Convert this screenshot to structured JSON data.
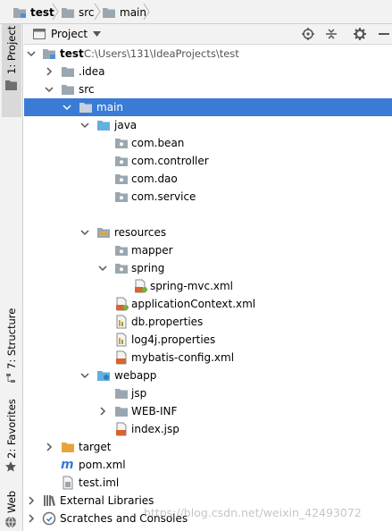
{
  "breadcrumb": {
    "items": [
      "test",
      "src",
      "main"
    ]
  },
  "stripe": {
    "project": "1: Project",
    "structure": "7: Structure",
    "favorites": "2: Favorites",
    "web": "Web"
  },
  "panel": {
    "view": "Project"
  },
  "tree": {
    "project_root": {
      "name": "test",
      "path": "C:\\Users\\131\\IdeaProjects\\test"
    },
    "idea": ".idea",
    "src": "src",
    "main": "main",
    "java": "java",
    "packages": [
      "com.bean",
      "com.controller",
      "com.dao",
      "com.service"
    ],
    "resources": "resources",
    "mapper": "mapper",
    "spring": "spring",
    "spring_mvc": "spring-mvc.xml",
    "files": [
      "applicationContext.xml",
      "db.properties",
      "log4j.properties",
      "mybatis-config.xml"
    ],
    "webapp": "webapp",
    "jsp": "jsp",
    "webinf": "WEB-INF",
    "index": "index.jsp",
    "target": "target",
    "pom": "pom.xml",
    "iml": "test.iml",
    "external": "External Libraries",
    "scratches": "Scratches and Consoles"
  },
  "watermark": "https://blog.csdn.net/weixin_42493072",
  "colors": {
    "selection": "#3a7bd5",
    "folder": "#9aa7b0",
    "source_folder": "#62b0de",
    "target_folder": "#e8a33d"
  }
}
